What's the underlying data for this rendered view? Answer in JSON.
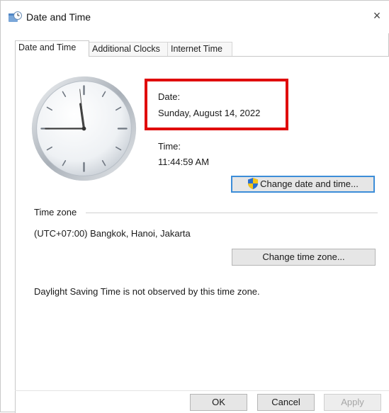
{
  "window": {
    "title": "Date and Time",
    "title_icon": "date-time-settings-icon",
    "close_glyph": "×"
  },
  "tabs": [
    {
      "label": "Date and Time",
      "active": true
    },
    {
      "label": "Additional Clocks",
      "active": false
    },
    {
      "label": "Internet Time",
      "active": false
    }
  ],
  "date_section": {
    "label": "Date:",
    "value": "Sunday, August 14, 2022",
    "highlight_color": "#e00a0a"
  },
  "time_section": {
    "label": "Time:",
    "value": "11:44:59 AM"
  },
  "analog_clock": {
    "hours": 11,
    "minutes": 44,
    "seconds": 59
  },
  "buttons": {
    "change_date_time": "Change date and time...",
    "change_time_zone": "Change time zone...",
    "ok": "OK",
    "cancel": "Cancel",
    "apply": "Apply"
  },
  "time_zone": {
    "legend": "Time zone",
    "value": "(UTC+07:00) Bangkok, Hanoi, Jakarta"
  },
  "dst_note": "Daylight Saving Time is not observed by this time zone.",
  "colors": {
    "accent_border": "#3c8dd8",
    "shield_blue": "#2a6fd0",
    "shield_yellow": "#f5c518"
  }
}
